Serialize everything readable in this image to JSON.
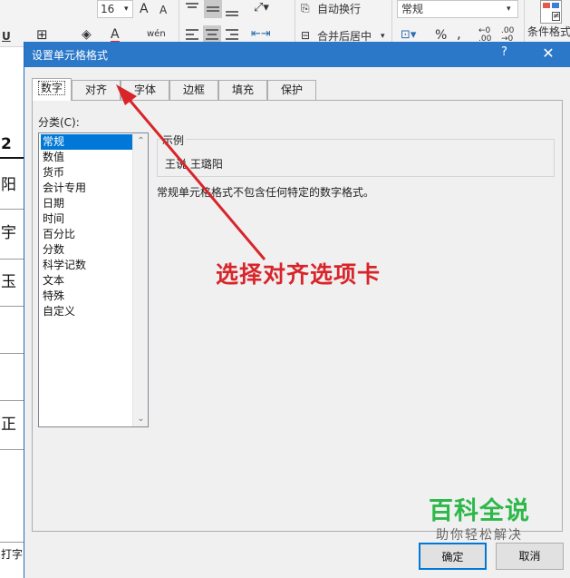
{
  "ribbon": {
    "font_size": "16",
    "grow_font": "A",
    "shrink_font": "A",
    "underline": "U",
    "wen_label": "wén",
    "wrap_text": "自动换行",
    "merge_center": "合并后居中",
    "number_format": "常规",
    "percent": "%",
    "comma": ",",
    "conditional_format": "条件格式",
    "font_color_letter": "A"
  },
  "sheet": {
    "cells": [
      "2",
      "阳",
      "宇",
      "玉",
      "",
      "",
      "正"
    ],
    "bottom_fragment": "打字"
  },
  "dialog": {
    "title": "设置单元格格式",
    "help": "?",
    "close": "✕",
    "tabs": [
      "数字",
      "对齐",
      "字体",
      "边框",
      "填充",
      "保护"
    ],
    "category_label": "分类(C):",
    "categories": [
      "常规",
      "数值",
      "货币",
      "会计专用",
      "日期",
      "时间",
      "百分比",
      "分数",
      "科学记数",
      "文本",
      "特殊",
      "自定义"
    ],
    "selected_category": "常规",
    "sample_legend": "示例",
    "sample_value": "王说 王璐阳",
    "description": "常规单元格格式不包含任何特定的数字格式。",
    "ok": "确定",
    "cancel": "取消"
  },
  "annotation": {
    "text": "选择对齐选项卡",
    "color": "#d8252a"
  },
  "watermark": {
    "main": "百科全说",
    "sub": "助你轻松解决"
  },
  "colors": {
    "titlebar": "#2b78c9",
    "selection": "#0078d7",
    "watermark_green": "#2db84a"
  }
}
